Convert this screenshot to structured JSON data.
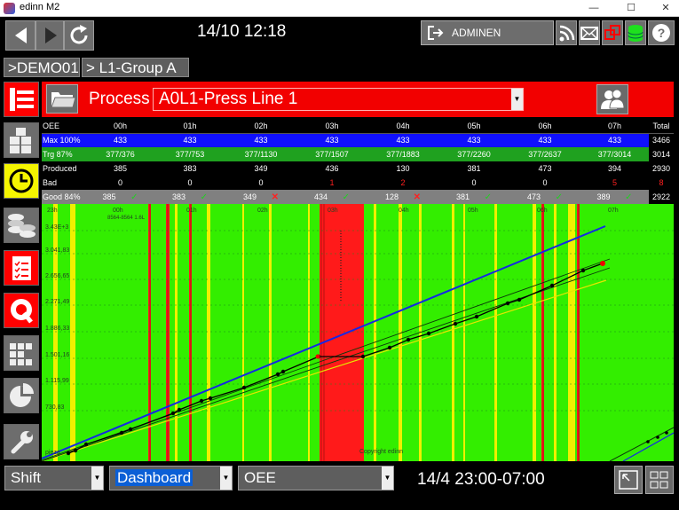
{
  "window": {
    "title": "edinn M2",
    "minimize": "—",
    "maximize": "☐",
    "close": "✕"
  },
  "topbar": {
    "clock": "14/10 12:18",
    "user": "ADMINEN"
  },
  "breadcrumbs": [
    ">DEMO01",
    "> L1-Group A"
  ],
  "process": {
    "label": "Process",
    "selected": "A0L1-Press Line 1"
  },
  "table": {
    "header": [
      "OEE",
      "00h",
      "01h",
      "02h",
      "03h",
      "04h",
      "05h",
      "06h",
      "07h",
      "Total"
    ],
    "rows": [
      {
        "label": "Max 100%",
        "values": [
          "433",
          "433",
          "433",
          "433",
          "433",
          "433",
          "433",
          "433"
        ],
        "total": "3466"
      },
      {
        "label": "Trg 87%",
        "values": [
          "377/376",
          "377/753",
          "377/1130",
          "377/1507",
          "377/1883",
          "377/2260",
          "377/2637",
          "377/3014"
        ],
        "total": "3014"
      },
      {
        "label": "Produced",
        "values": [
          "385",
          "383",
          "349",
          "436",
          "130",
          "381",
          "473",
          "394"
        ],
        "total": "2930"
      },
      {
        "label": "Bad",
        "values": [
          "0",
          "0",
          "0",
          "1",
          "2",
          "0",
          "0",
          "5"
        ],
        "total": "8"
      },
      {
        "label": "Good 84%",
        "values": [
          "385",
          "383",
          "349",
          "434",
          "128",
          "381",
          "473",
          "389"
        ],
        "total": "2922"
      }
    ]
  },
  "chart_data": {
    "type": "line",
    "x_tick_labels": [
      "23h",
      "00h",
      "01h",
      "02h",
      "03h",
      "04h",
      "05h",
      "06h",
      "07h"
    ],
    "y_tick_labels": [
      "3.43E+3",
      "3.041,83",
      "2.656,65",
      "2.271,49",
      "1.886,33",
      "1.501,16",
      "1.115,99",
      "730,83"
    ],
    "annotation": "8564-8564 1.6L",
    "copyright": "Copyright edinn",
    "corner_label": "pieza",
    "colors": {
      "running": "#33ee00",
      "stopped": "#ff1a1a",
      "warning": "#f0f000",
      "max": "#1428e6",
      "target": "#e6e600"
    }
  },
  "bottom": {
    "shift_label": "Shift",
    "view_label": "Dashboard",
    "metric_label": "OEE",
    "range": "14/4 23:00-07:00",
    "arrow": "▼"
  }
}
